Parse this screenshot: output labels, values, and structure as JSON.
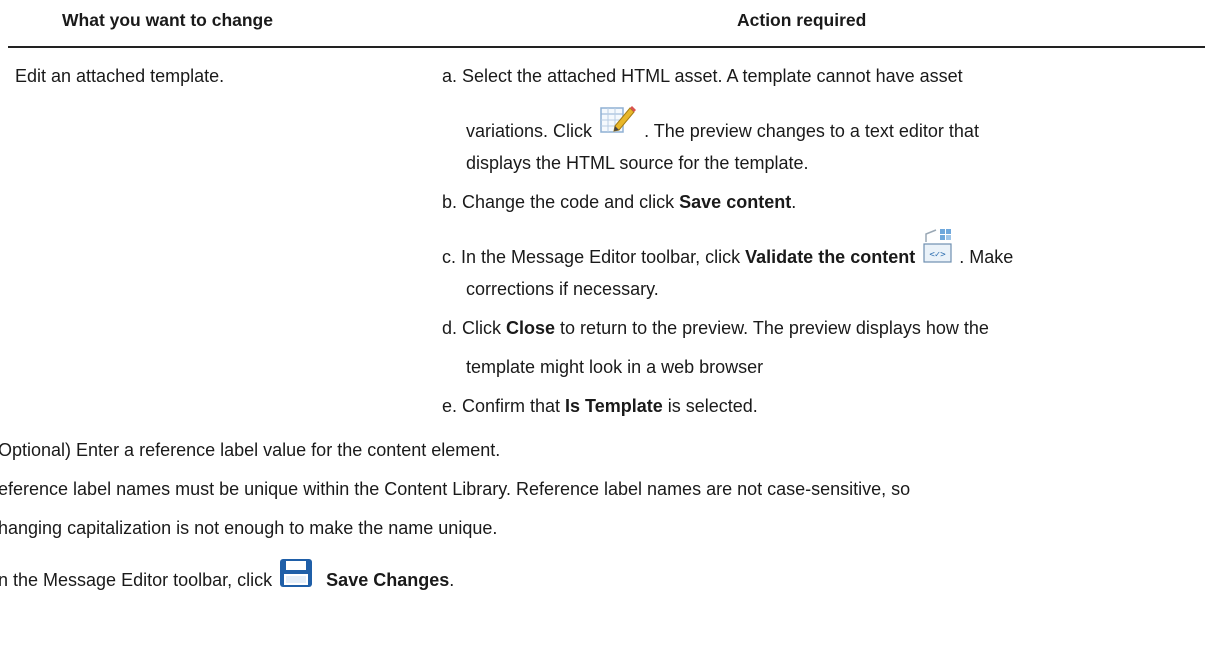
{
  "table": {
    "col1_header": "What you want to change",
    "col2_header": "Action required",
    "row_change": "Edit an attached template.",
    "steps": {
      "a1": "a. Select the attached HTML asset. A template cannot have asset",
      "a2_pre": "variations. Click",
      "a2_post": ". The preview changes to a text editor that",
      "a3": "displays the HTML source for the template.",
      "b_pre": "b. Change the code and click ",
      "b_bold": "Save content",
      "b_post": ".",
      "c_pre": "c. In the Message Editor toolbar, click ",
      "c_bold": "Validate the content",
      "c_post": ". Make",
      "c2": "corrections if necessary.",
      "d_pre": "d. Click ",
      "d_bold": "Close",
      "d_post": " to return to the preview. The preview displays how the",
      "d2": "template might look in a web browser",
      "e_pre": "e. Confirm that ",
      "e_bold": "Is Template",
      "e_post": " is selected."
    }
  },
  "body": {
    "optional": "Optional) Enter a reference label value for the content element.",
    "ref1": "eference label names must be unique within the Content Library. Reference label names are not case-sensitive, so",
    "ref2": "hanging capitalization is not enough to make the name unique.",
    "save_pre": "n the Message Editor toolbar, click",
    "save_bold": "Save Changes",
    "save_post": "."
  },
  "icons": {
    "edit": "edit-source-icon",
    "validate": "validate-content-icon",
    "save": "save-changes-icon"
  }
}
